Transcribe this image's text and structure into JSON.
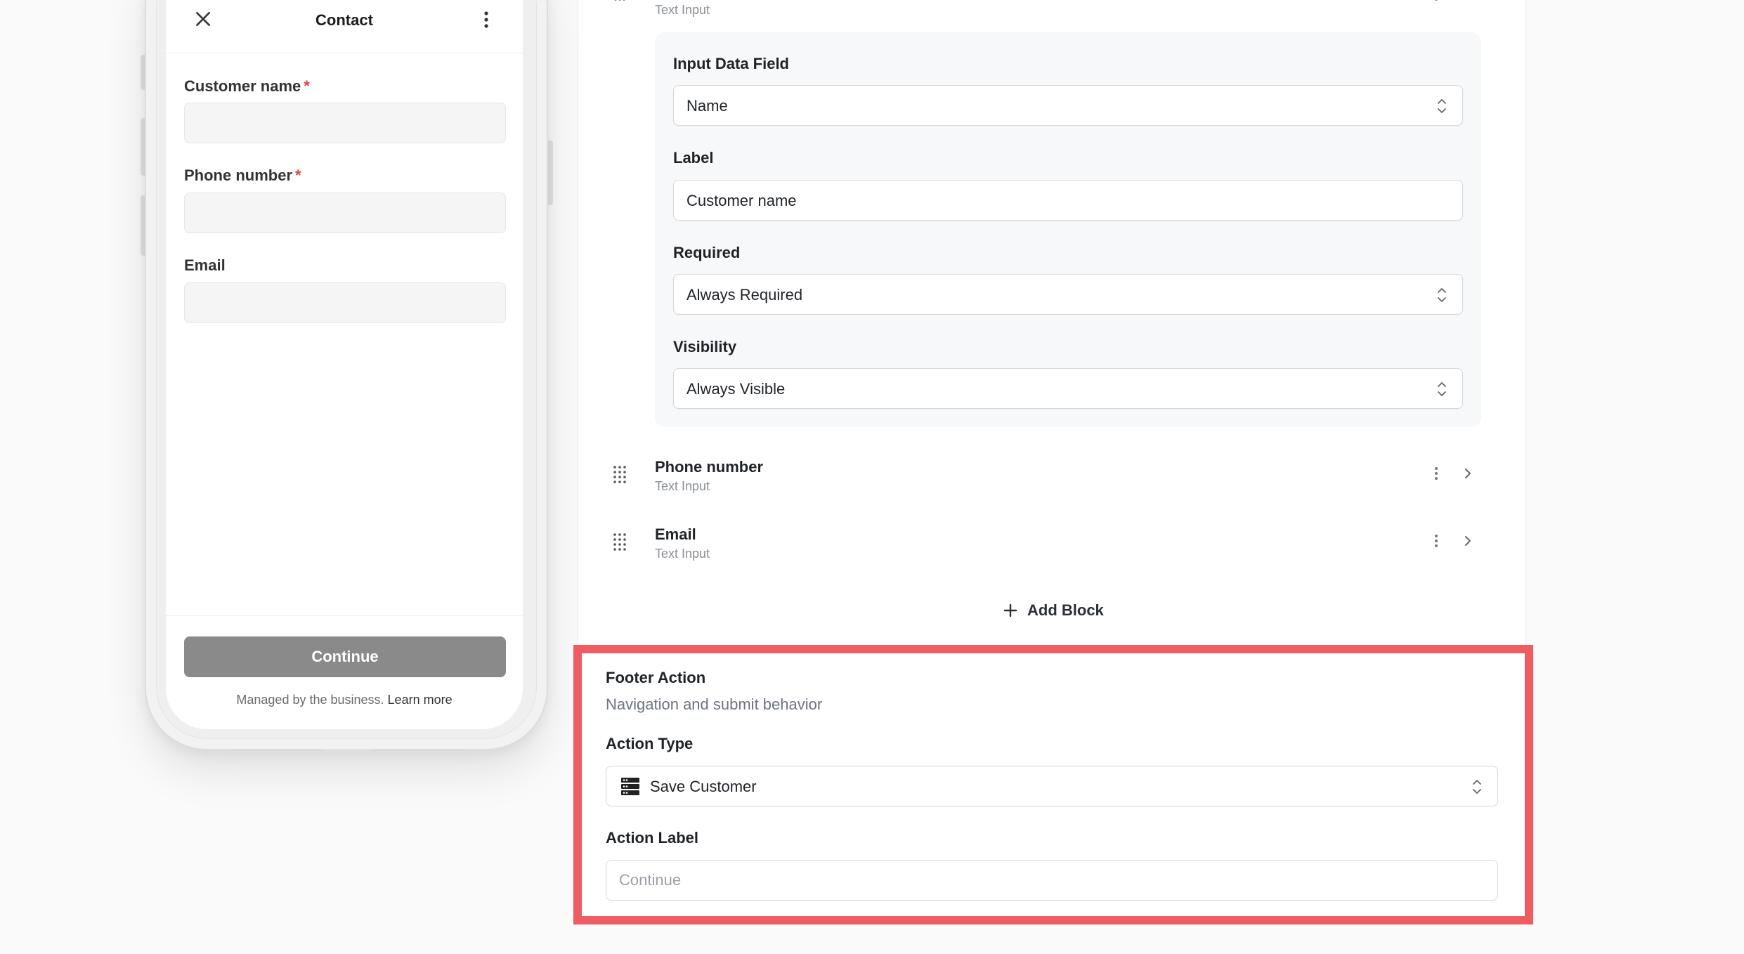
{
  "phone": {
    "title": "Contact",
    "fields": [
      {
        "label": "Customer name",
        "required_mark": "*"
      },
      {
        "label": "Phone number",
        "required_mark": "*"
      },
      {
        "label": "Email",
        "required_mark": ""
      }
    ],
    "continue_label": "Continue",
    "managed_text": "Managed by the business.",
    "learn_more": "Learn more"
  },
  "editor": {
    "top_block_subtitle": "Text Input",
    "fields_card": {
      "input_data_field": {
        "label": "Input Data Field",
        "value": "Name"
      },
      "label_field": {
        "label": "Label",
        "value": "Customer name"
      },
      "required_field": {
        "label": "Required",
        "value": "Always Required"
      },
      "visibility_field": {
        "label": "Visibility",
        "value": "Always Visible"
      }
    },
    "blocks": [
      {
        "title": "Phone number",
        "subtitle": "Text Input"
      },
      {
        "title": "Email",
        "subtitle": "Text Input"
      }
    ],
    "add_block_label": "Add Block"
  },
  "footer_action": {
    "title": "Footer Action",
    "subtitle": "Navigation and submit behavior",
    "action_type_label": "Action Type",
    "action_type_value": "Save Customer",
    "action_label_label": "Action Label",
    "action_label_placeholder": "Continue"
  },
  "colors": {
    "highlight": "#ef5c62",
    "continue_button": "#8a8a8a",
    "required_mark": "#e0473e"
  }
}
